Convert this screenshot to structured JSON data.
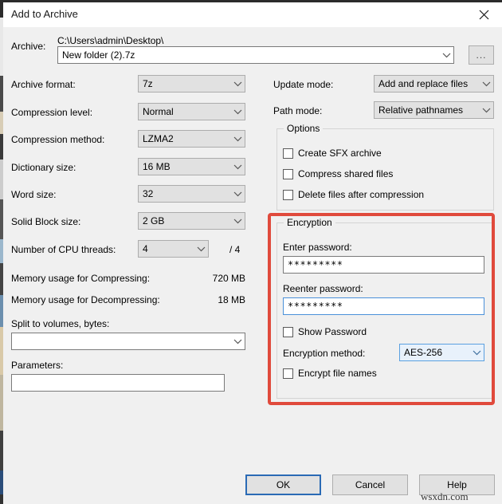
{
  "window": {
    "title": "Add to Archive",
    "close_icon": "close-icon"
  },
  "archive": {
    "label": "Archive:",
    "path": "C:\\Users\\admin\\Desktop\\",
    "name_value": "New folder (2).7z",
    "browse_label": "...",
    "dropdown_icon": "chevron-down-icon"
  },
  "left_column": {
    "archive_format": {
      "label": "Archive format:",
      "value": "7z"
    },
    "compression_level": {
      "label": "Compression level:",
      "value": "Normal"
    },
    "compression_method": {
      "label": "Compression method:",
      "value": "LZMA2"
    },
    "dictionary_size": {
      "label": "Dictionary size:",
      "value": "16 MB"
    },
    "word_size": {
      "label": "Word size:",
      "value": "32"
    },
    "solid_block_size": {
      "label": "Solid Block size:",
      "value": "2 GB"
    },
    "cpu_threads": {
      "label": "Number of CPU threads:",
      "value": "4",
      "total": "/ 4"
    },
    "memory_compressing": {
      "label": "Memory usage for Compressing:",
      "value": "720 MB"
    },
    "memory_decompressing": {
      "label": "Memory usage for Decompressing:",
      "value": "18 MB"
    },
    "split_volumes": {
      "label": "Split to volumes, bytes:",
      "value": ""
    },
    "parameters": {
      "label": "Parameters:",
      "value": ""
    }
  },
  "right_column": {
    "update_mode": {
      "label": "Update mode:",
      "value": "Add and replace files"
    },
    "path_mode": {
      "label": "Path mode:",
      "value": "Relative pathnames"
    },
    "options": {
      "title": "Options",
      "items": [
        {
          "label": "Create SFX archive",
          "checked": false
        },
        {
          "label": "Compress shared files",
          "checked": false
        },
        {
          "label": "Delete files after compression",
          "checked": false
        }
      ]
    },
    "encryption": {
      "title": "Encryption",
      "enter_password": {
        "label": "Enter password:",
        "value": "*********"
      },
      "reenter_password": {
        "label": "Reenter password:",
        "value": "*********"
      },
      "show_password": {
        "label": "Show Password",
        "checked": false
      },
      "encryption_method": {
        "label": "Encryption method:",
        "value": "AES-256"
      },
      "encrypt_file_names": {
        "label": "Encrypt file names",
        "checked": false
      }
    }
  },
  "footer": {
    "ok": "OK",
    "cancel": "Cancel",
    "help": "Help"
  },
  "watermark": "wsxdn.com",
  "colors": {
    "highlight_red": "#e04a3c",
    "focus_blue": "#4a90d9",
    "dialog_bg": "#f0f0f0"
  }
}
